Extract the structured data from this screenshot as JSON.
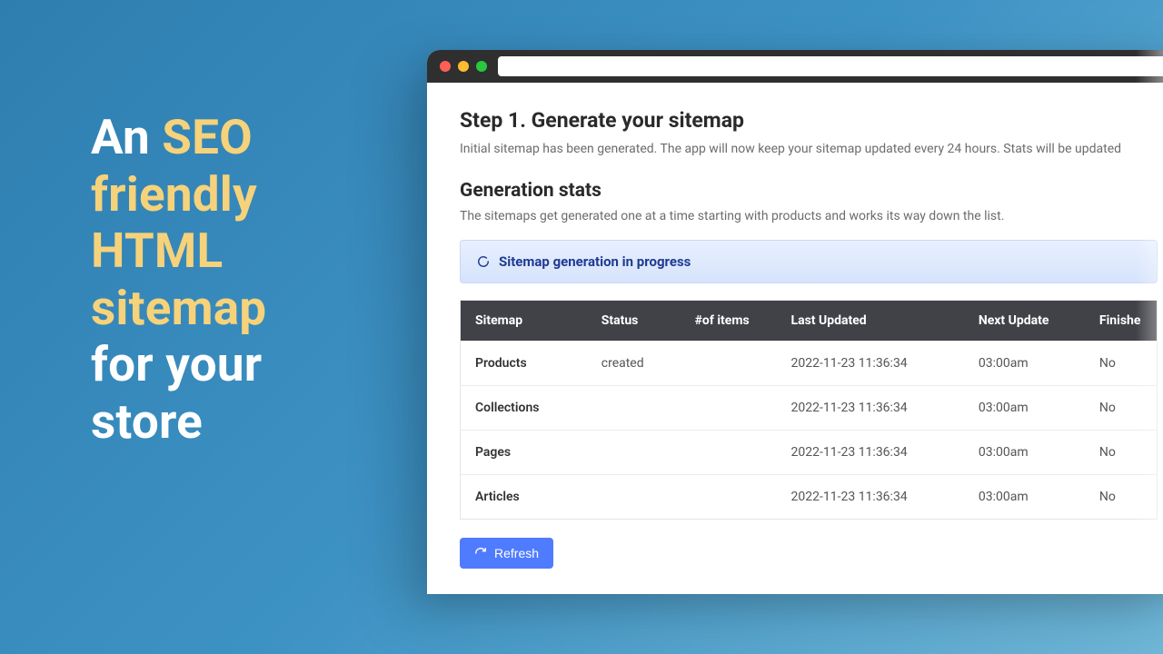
{
  "headline": {
    "line1_pre": "An ",
    "line1_accent": "SEO",
    "line2_accent": "friendly",
    "line3_accent": "HTML",
    "line4_accent": "sitemap",
    "line5_plain": "for your",
    "line6_plain": "store"
  },
  "step": {
    "title": "Step 1. Generate your sitemap",
    "description": "Initial sitemap has been generated. The app will now keep your sitemap updated every 24 hours. Stats will be updated"
  },
  "stats": {
    "title": "Generation stats",
    "description": "The sitemaps get generated one at a time starting with products and works its way down the list."
  },
  "banner": {
    "text": "Sitemap generation in progress"
  },
  "table": {
    "headers": {
      "sitemap": "Sitemap",
      "status": "Status",
      "items": "#of items",
      "last": "Last Updated",
      "next": "Next Update",
      "finished": "Finishe"
    },
    "rows": [
      {
        "sitemap": "Products",
        "status": "created",
        "items": "",
        "last": "2022-11-23 11:36:34",
        "next": "03:00am",
        "finished": "No"
      },
      {
        "sitemap": "Collections",
        "status": "",
        "items": "",
        "last": "2022-11-23 11:36:34",
        "next": "03:00am",
        "finished": "No"
      },
      {
        "sitemap": "Pages",
        "status": "",
        "items": "",
        "last": "2022-11-23 11:36:34",
        "next": "03:00am",
        "finished": "No"
      },
      {
        "sitemap": "Articles",
        "status": "",
        "items": "",
        "last": "2022-11-23 11:36:34",
        "next": "03:00am",
        "finished": "No"
      }
    ]
  },
  "buttons": {
    "refresh": "Refresh"
  }
}
